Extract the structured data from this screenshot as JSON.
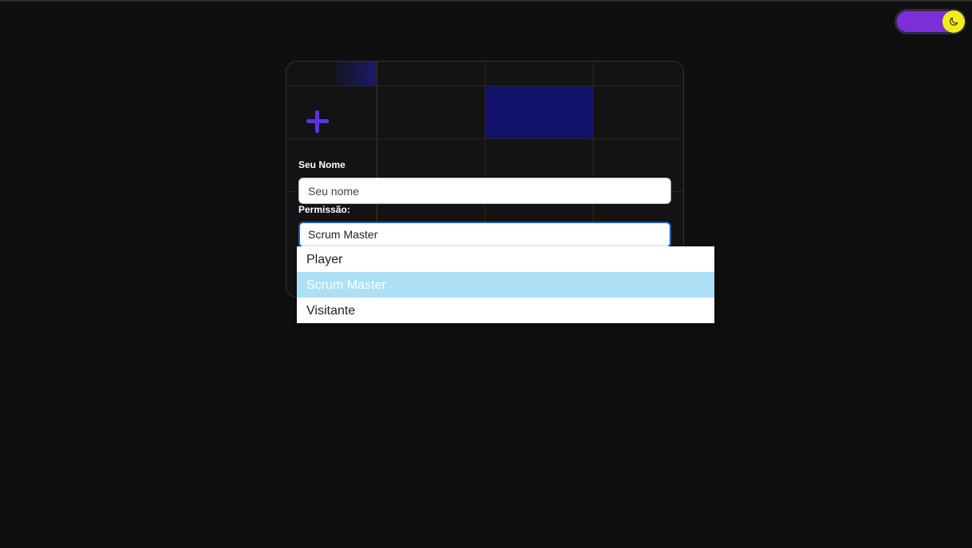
{
  "theme_toggle": {
    "icon": "moon-icon",
    "track_color": "#7b2fd9",
    "knob_color": "#f3ec1a"
  },
  "form": {
    "name_label": "Seu Nome",
    "name_placeholder": "Seu nome",
    "name_value": "",
    "permission_label": "Permissão:",
    "permission_selected": "Scrum Master"
  },
  "dropdown": {
    "options": [
      "Player",
      "Scrum Master",
      "Visitante"
    ],
    "selected_index": 1
  },
  "colors": {
    "background": "#0f0f0f",
    "accent_plus": "#5a34e0",
    "selected_option_bg": "#ade0f4",
    "focus_border": "#1f5fb4"
  }
}
